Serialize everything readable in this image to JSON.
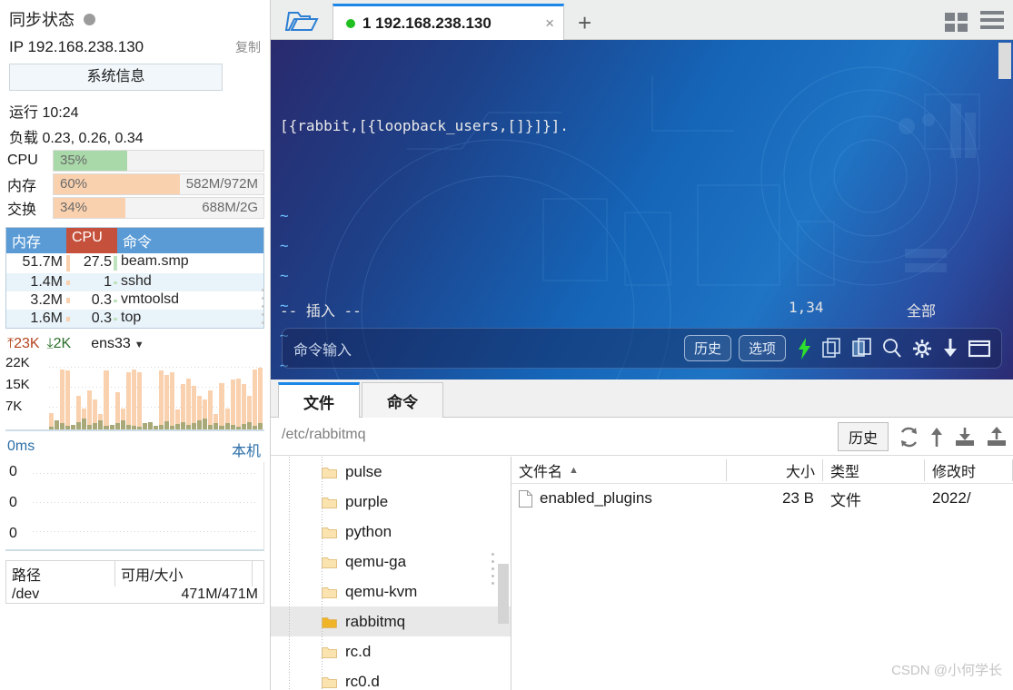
{
  "monitor": {
    "sync_label": "同步状态",
    "sync_dot_color": "#9b9b9b",
    "ip_label": "IP 192.168.238.130",
    "copy_label": "复制",
    "sysinfo_button": "系统信息",
    "uptime": "运行 10:24",
    "load": "负载 0.23, 0.26, 0.34",
    "bars": [
      {
        "name": "CPU",
        "pct_text": "35%",
        "pct": 35,
        "detail": "",
        "color": "#a9d9a9"
      },
      {
        "name": "内存",
        "pct_text": "60%",
        "pct": 60,
        "detail": "582M/972M",
        "color": "#fad1ae"
      },
      {
        "name": "交换",
        "pct_text": "34%",
        "pct": 34,
        "detail": "688M/2G",
        "color": "#fad1ae"
      }
    ],
    "process_table": {
      "headers": {
        "mem": "内存",
        "cpu": "CPU",
        "cmd": "命令"
      },
      "header_mem_color": "#5b9bd5",
      "header_cpu_color": "#c5503b",
      "rows": [
        {
          "mem": "51.7M",
          "cpu": "27.5",
          "cmd": "beam.smp",
          "mem_bar": 18,
          "cpu_bar": 16
        },
        {
          "mem": "1.4M",
          "cpu": "1",
          "cmd": "sshd",
          "mem_bar": 5,
          "cpu_bar": 3
        },
        {
          "mem": "3.2M",
          "cpu": "0.3",
          "cmd": "vmtoolsd",
          "mem_bar": 6,
          "cpu_bar": 3
        },
        {
          "mem": "1.6M",
          "cpu": "0.3",
          "cmd": "top",
          "mem_bar": 5,
          "cpu_bar": 3
        }
      ]
    },
    "network": {
      "up": "23K",
      "down": "2K",
      "interface": "ens33",
      "y_labels": [
        "22K",
        "15K",
        "7K"
      ],
      "up_color": "#fad1ae",
      "down_color": "#a8a878"
    },
    "ping": {
      "latency": "0ms",
      "host": "本机",
      "zero_labels": [
        "0",
        "0",
        "0"
      ]
    },
    "disk": {
      "headers": {
        "path": "路径",
        "avail": "可用/大小"
      },
      "rows": [
        {
          "path": "/dev",
          "avail": "471M/471M"
        }
      ]
    }
  },
  "tabbar": {
    "folder_icon": "folder-open-icon",
    "tab": {
      "title": "1 192.168.238.130",
      "dot_color": "#20c020",
      "close": "×"
    },
    "add_label": "+",
    "grid_icon": "grid-view-icon",
    "menu_icon": "hamburger-menu-icon"
  },
  "terminal": {
    "content_line": "[{rabbit,[{loopback_users,[]}]}].",
    "tilde_lines": [
      "~",
      "~",
      "~",
      "~",
      "~",
      "~"
    ],
    "status": {
      "mode": "-- 插入 --",
      "position": "1,34",
      "scope": "全部"
    }
  },
  "cmdbar": {
    "placeholder": "命令输入",
    "history_label": "历史",
    "options_label": "选项",
    "icons": [
      "lightning-icon",
      "copy-icon",
      "paste-icon",
      "search-icon",
      "gear-icon",
      "download-icon",
      "window-icon"
    ],
    "lightning_color": "#2ee02e"
  },
  "filebrowser": {
    "tabs": [
      {
        "label": "文件",
        "active": true
      },
      {
        "label": "命令",
        "active": false
      }
    ],
    "path": "/etc/rabbitmq",
    "history_label": "历史",
    "tool_icons": [
      "refresh-icon",
      "up-arrow-icon",
      "download-icon",
      "upload-icon"
    ],
    "tree": [
      {
        "name": "pulse",
        "selected": false
      },
      {
        "name": "purple",
        "selected": false
      },
      {
        "name": "python",
        "selected": false
      },
      {
        "name": "qemu-ga",
        "selected": false
      },
      {
        "name": "qemu-kvm",
        "selected": false
      },
      {
        "name": "rabbitmq",
        "selected": true
      },
      {
        "name": "rc.d",
        "selected": false
      },
      {
        "name": "rc0.d",
        "selected": false
      }
    ],
    "list_headers": {
      "name": "文件名",
      "size": "大小",
      "type": "类型",
      "time": "修改时"
    },
    "sort_indicator": "▲",
    "files": [
      {
        "name": "enabled_plugins",
        "size": "23 B",
        "type": "文件",
        "time": "2022/"
      }
    ]
  },
  "watermark": "CSDN @小何学长"
}
